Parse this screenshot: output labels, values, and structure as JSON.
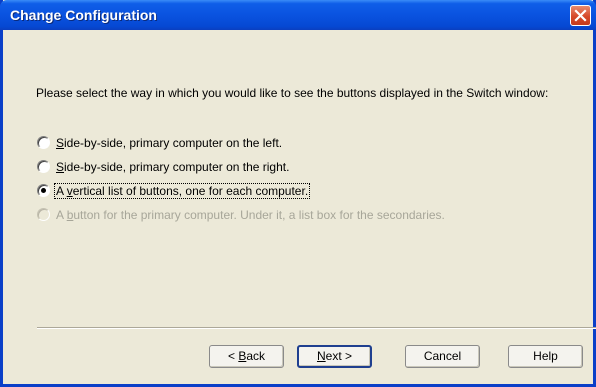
{
  "window": {
    "title": "Change Configuration",
    "close_icon": "close-icon"
  },
  "prompt": {
    "text": "Please select the way in which you would like to see the buttons displayed in the Switch window:"
  },
  "options": [
    {
      "mnemonic": "S",
      "rest": "ide-by-side, primary computer on the left.",
      "selected": false,
      "enabled": true
    },
    {
      "mnemonic": "S",
      "rest": "ide-by-side, primary computer on the right.",
      "selected": false,
      "enabled": true
    },
    {
      "pre": "A ",
      "mnemonic": "v",
      "rest": "ertical list of buttons, one for each computer.",
      "selected": true,
      "enabled": true
    },
    {
      "pre": "A ",
      "mnemonic": "b",
      "rest": "utton for the primary computer. Under it, a list box for the secondaries.",
      "selected": false,
      "enabled": false
    }
  ],
  "buttons": {
    "back_pre": "< ",
    "back_mnemonic": "B",
    "back_rest": "ack",
    "next_mnemonic": "N",
    "next_rest": "ext >",
    "cancel": "Cancel",
    "help": "Help"
  }
}
